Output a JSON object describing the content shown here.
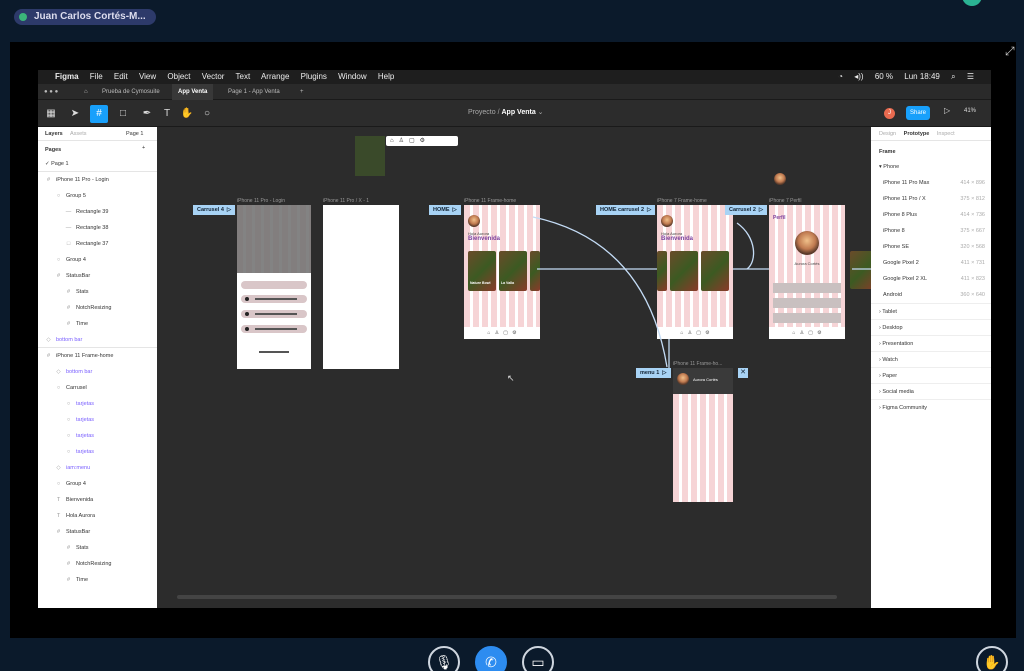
{
  "meeting": {
    "participant_name": "Juan Carlos Cortés-M..."
  },
  "mac_menu": {
    "items": [
      "Figma",
      "File",
      "Edit",
      "View",
      "Object",
      "Vector",
      "Text",
      "Arrange",
      "Plugins",
      "Window",
      "Help"
    ],
    "battery": "60 %",
    "clock": "Lun 18:49"
  },
  "tabs": [
    {
      "label": "Prueba de Cymosuite"
    },
    {
      "label": "App Venta"
    },
    {
      "label": "Page 1 - App Venta"
    }
  ],
  "toolbar": {
    "project": "Proyecto",
    "separator": "/",
    "file": "App Venta",
    "share_label": "Share",
    "zoom": "41%",
    "avatar_initial": "J"
  },
  "left_panel": {
    "tab_layers": "Layers",
    "tab_assets": "Assets",
    "page_selector": "Page 1",
    "pages_label": "Pages",
    "current_page": "Page 1",
    "layers": [
      {
        "label": "iPhone 11 Pro - Login",
        "icon": "#",
        "kind": "frame"
      },
      {
        "label": "Group 5",
        "icon": "○",
        "kind": "group"
      },
      {
        "label": "Rectangle 39",
        "icon": "—",
        "kind": "shape"
      },
      {
        "label": "Rectangle 38",
        "icon": "—",
        "kind": "shape"
      },
      {
        "label": "Rectangle 37",
        "icon": "□",
        "kind": "shape"
      },
      {
        "label": "Group 4",
        "icon": "○",
        "kind": "group"
      },
      {
        "label": "StatusBar",
        "icon": "#",
        "kind": "frame"
      },
      {
        "label": "Stats",
        "icon": "#",
        "kind": "frame"
      },
      {
        "label": "NotchResizing",
        "icon": "#",
        "kind": "frame"
      },
      {
        "label": "Time",
        "icon": "#",
        "kind": "frame"
      },
      {
        "label": "bottom bar",
        "icon": "◇",
        "kind": "component"
      },
      {
        "label": "iPhone 11 Frame-home",
        "icon": "#",
        "kind": "frame"
      },
      {
        "label": "bottom bar",
        "icon": "◇",
        "kind": "component"
      },
      {
        "label": "Carrusel",
        "icon": "○",
        "kind": "group"
      },
      {
        "label": "tarjetas",
        "icon": "○",
        "kind": "component"
      },
      {
        "label": "tarjetas",
        "icon": "○",
        "kind": "component"
      },
      {
        "label": "tarjetas",
        "icon": "○",
        "kind": "component"
      },
      {
        "label": "tarjetas",
        "icon": "○",
        "kind": "component"
      },
      {
        "label": "iam:menu",
        "icon": "◇",
        "kind": "component"
      },
      {
        "label": "Group 4",
        "icon": "○",
        "kind": "group"
      },
      {
        "label": "Bienvenida",
        "icon": "T",
        "kind": "text"
      },
      {
        "label": "Hola Aurora",
        "icon": "T",
        "kind": "text"
      },
      {
        "label": "StatusBar",
        "icon": "#",
        "kind": "frame"
      },
      {
        "label": "Stats",
        "icon": "#",
        "kind": "frame"
      },
      {
        "label": "NotchResizing",
        "icon": "#",
        "kind": "frame"
      },
      {
        "label": "Time",
        "icon": "#",
        "kind": "frame"
      }
    ]
  },
  "right_panel": {
    "tab_design": "Design",
    "tab_prototype": "Prototype",
    "tab_inspect": "Inspect",
    "section_frame": "Frame",
    "section_phone": "Phone",
    "devices": [
      {
        "name": "iPhone 11 Pro Max",
        "size": "414 × 896"
      },
      {
        "name": "iPhone 11 Pro / X",
        "size": "375 × 812"
      },
      {
        "name": "iPhone 8 Plus",
        "size": "414 × 736"
      },
      {
        "name": "iPhone 8",
        "size": "375 × 667"
      },
      {
        "name": "iPhone SE",
        "size": "320 × 568"
      },
      {
        "name": "Google Pixel 2",
        "size": "411 × 731"
      },
      {
        "name": "Google Pixel 2 XL",
        "size": "411 × 823"
      },
      {
        "name": "Android",
        "size": "360 × 640"
      }
    ],
    "categories": [
      "Tablet",
      "Desktop",
      "Presentation",
      "Watch",
      "Paper",
      "Social media",
      "Figma Community"
    ],
    "help": "?"
  },
  "canvas": {
    "frame_labels": [
      "iPhone 11 Pro - Login",
      "iPhone 11 Pro / X - 1",
      "iPhone 11 Frame-home",
      "iPhone 7 Frame-home",
      "iPhone 7 Perfil",
      "iPhone 11 Frame-ho...",
      "iPhone"
    ],
    "flows": [
      "Carrusel 4",
      "HOME",
      "HOME carrusel 2",
      "Carrusel 2",
      "menu 1"
    ],
    "home_greeting": "Hola Aurora",
    "home_title": "Bienvenida",
    "card_title": "Nature Bowl",
    "card_title_2": "La Valla",
    "profile_title": "Perfil",
    "profile_name": "Aurora Cortés",
    "menu_name": "Aurora Cortés",
    "close": "✕"
  }
}
